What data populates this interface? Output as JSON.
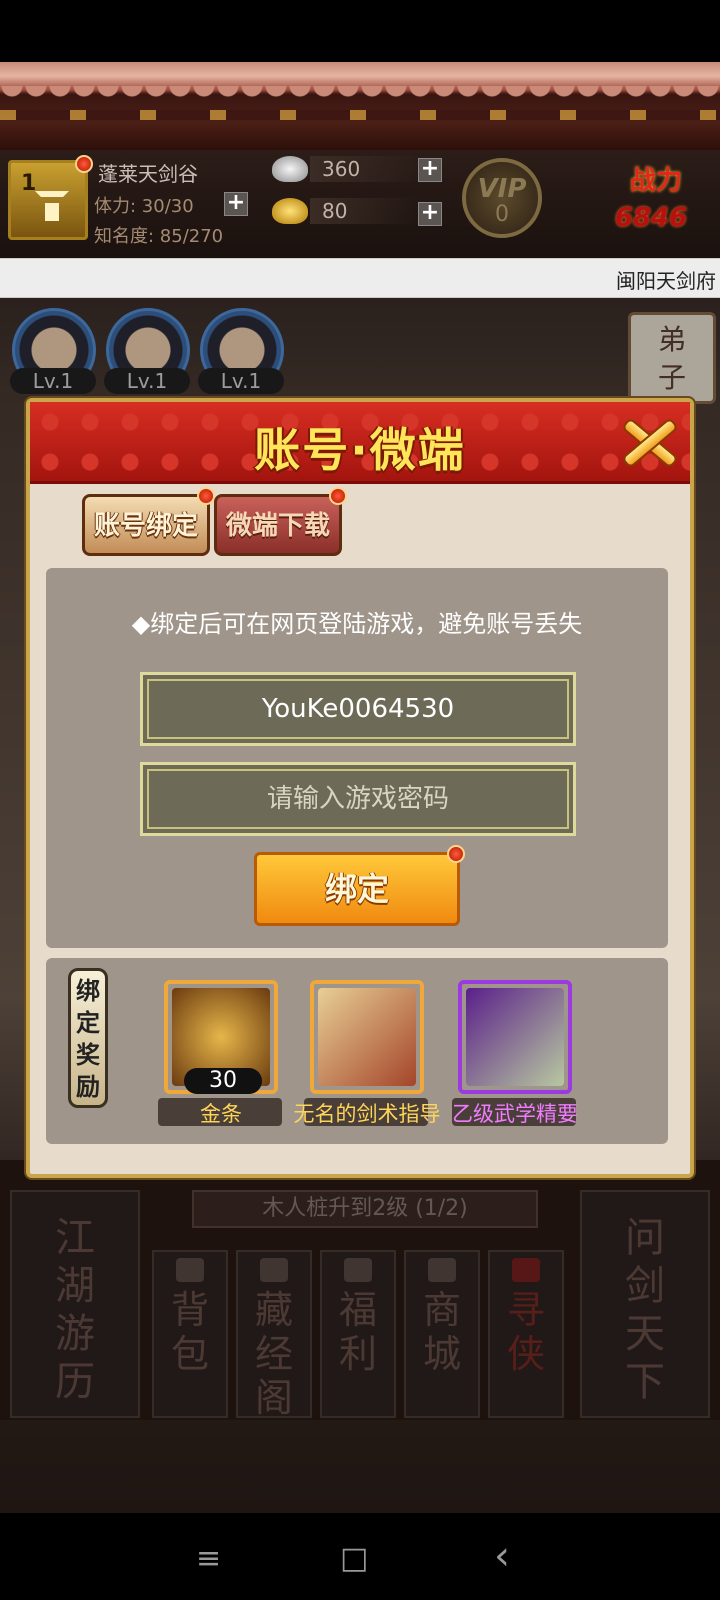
{
  "hud": {
    "player_level": "1",
    "player_name": "蓬莱天剑谷",
    "stamina": "体力: 30/30",
    "fame": "知名度: 85/270",
    "silver": "360",
    "gold": "80",
    "vip_title": "VIP",
    "vip_level": "0",
    "power_title": "战力",
    "power_value": "6846"
  },
  "marquee": "闽阳天剑府",
  "disciples": [
    {
      "level": "Lv.1"
    },
    {
      "level": "Lv.1"
    },
    {
      "level": "Lv.1"
    }
  ],
  "disciple_detail": "弟子详情",
  "dialog": {
    "title": "账号·微端",
    "tabs": [
      {
        "label": "账号绑定",
        "active": true
      },
      {
        "label": "微端下载",
        "active": false
      }
    ],
    "hint": "◆绑定后可在网页登陆游戏，避免账号丢失",
    "account_value": "YouKe0064530",
    "password_placeholder": "请输入游戏密码",
    "bind_button": "绑定",
    "reward_label": "绑定奖励",
    "rewards": [
      {
        "name": "金条",
        "count": "30",
        "name_color": "#ffd45a"
      },
      {
        "name": "无名的剑术指导",
        "name_color": "#ffd45a"
      },
      {
        "name": "乙级武学精要",
        "name_color": "#f07cff"
      }
    ]
  },
  "task": "木人桩升到2级  (1/2)",
  "bottom_menu": [
    "江湖游历",
    "背包",
    "藏经阁",
    "福利",
    "商城",
    "寻侠",
    "问剑天下"
  ],
  "navbar": {
    "menu": "≡",
    "home": "□",
    "back": "‹"
  },
  "colors": {
    "dialog_header": "#c0201a",
    "bind_button": "#f5a21a",
    "rarity_purple": "#8a2fd0"
  }
}
